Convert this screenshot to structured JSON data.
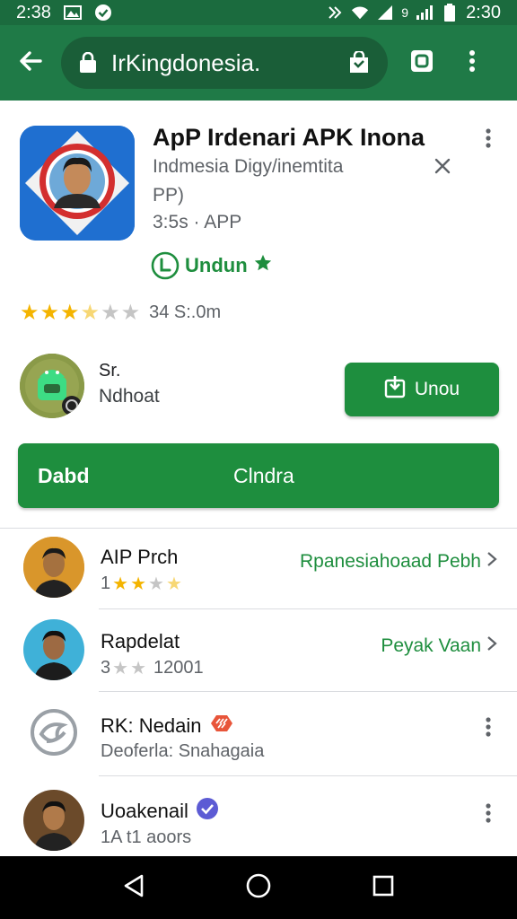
{
  "status_bar": {
    "time_left": "2:38",
    "time_right": "2:30",
    "signal_text": "9"
  },
  "browser": {
    "url": "IrKingdonesia."
  },
  "app": {
    "title": "ApP Irdenari APK Inona",
    "developer_line1": "Indmesia  Digy/inemtita",
    "developer_line2": "PP)",
    "meta": "3:5s · APP",
    "badge_label": "Undun",
    "rating_stars": 3.5,
    "rating_text": "34 S:.0m"
  },
  "developer": {
    "name": "Sr.",
    "subtitle": "Ndhoat"
  },
  "buttons": {
    "install_label": "Unou",
    "wide_left": "Dabd",
    "wide_center": "Clndra"
  },
  "list": [
    {
      "title": "AIP Prch",
      "rating_prefix": "1",
      "stars": 3,
      "extra": "",
      "link": "Rpanesiahoaad Pebh"
    },
    {
      "title": "Rapdelat",
      "rating_prefix": "3",
      "stars": 2,
      "extra": "12001",
      "link": "Peyak Vaan"
    },
    {
      "title": "RK: Nedain",
      "subtitle": "Deoferla: Snahagaia"
    },
    {
      "title": "Uoakenail",
      "subtitle": "1A  t1 aoors"
    }
  ],
  "colors": {
    "status_bar": "#1b6b3e",
    "app_bar": "#1f7a47",
    "accent_green": "#1e8e3e",
    "star_gold": "#f4b400"
  },
  "icons": {
    "back": "arrow-left-icon",
    "lock": "lock-icon",
    "shop": "shopping-bag-icon",
    "tabs": "tabs-icon",
    "menu": "more-vert-icon",
    "close": "close-icon",
    "nav_back": "triangle-back-icon",
    "nav_home": "circle-home-icon",
    "nav_recents": "square-recents-icon"
  }
}
